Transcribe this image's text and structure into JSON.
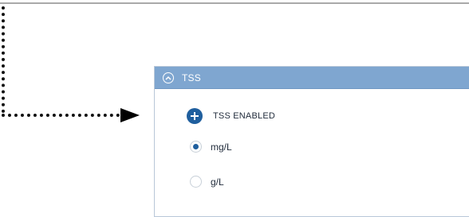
{
  "panel": {
    "title": "TSS",
    "enabled_label": "TSS ENABLED",
    "unit_options": [
      {
        "label": "mg/L",
        "selected": true
      },
      {
        "label": "g/L",
        "selected": false
      }
    ]
  },
  "icons": {
    "collapse": "chevron-up-circle-icon",
    "enable": "plus-circle-icon",
    "callout_arrow": "dotted-arrow"
  },
  "colors": {
    "header_bg": "#7fa6d0",
    "accent": "#1f5f9e",
    "callout": "#000000"
  }
}
